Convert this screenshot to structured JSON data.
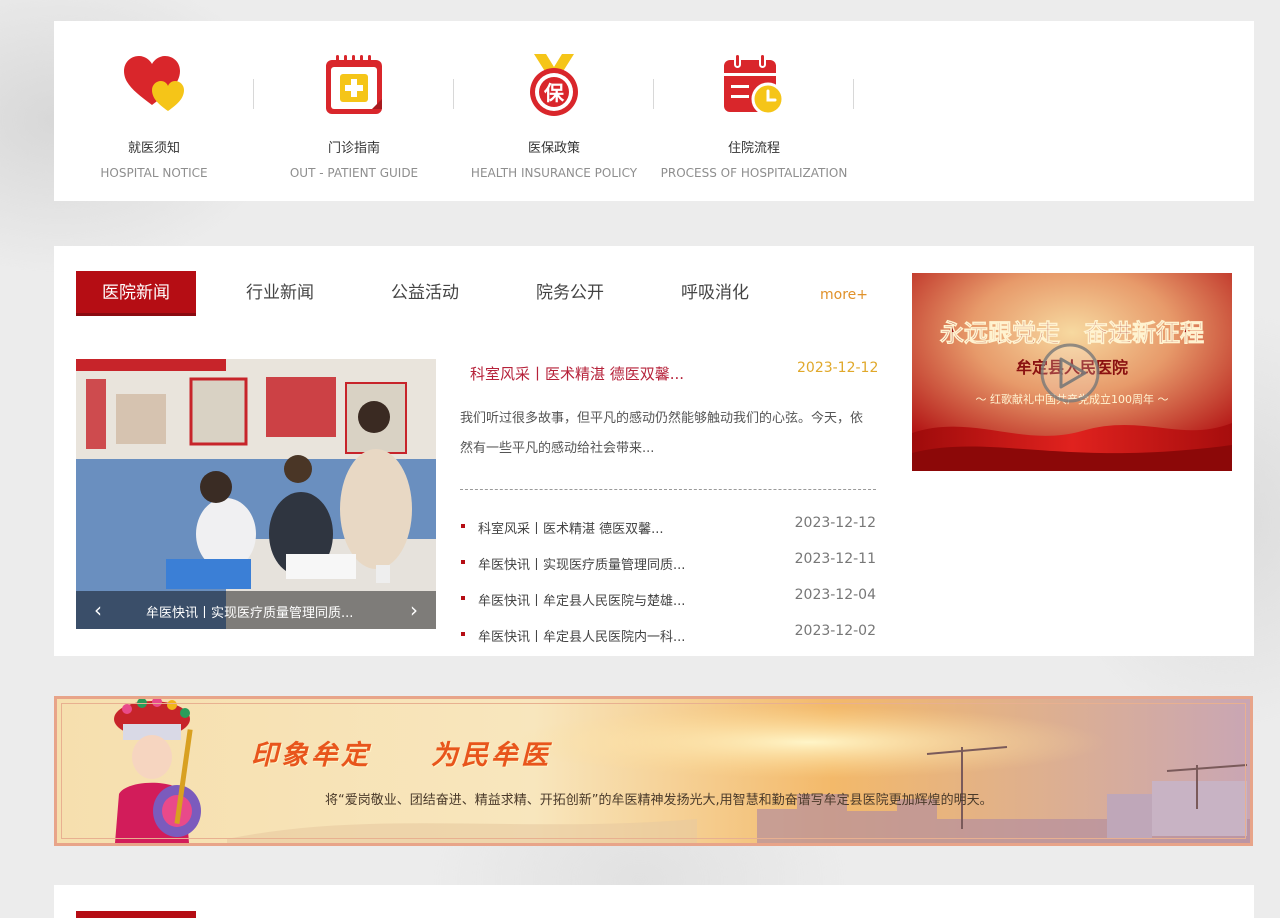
{
  "quick_links": [
    {
      "title": "就医须知",
      "subtitle": "HOSPITAL NOTICE",
      "icon": "hearts-icon"
    },
    {
      "title": "门诊指南",
      "subtitle": "OUT - PATIENT GUIDE",
      "icon": "medical-calendar-icon"
    },
    {
      "title": "医保政策",
      "subtitle": "HEALTH INSURANCE POLICY",
      "icon": "insurance-medal-icon"
    },
    {
      "title": "住院流程",
      "subtitle": "PROCESS OF HOSPITALIZATION",
      "icon": "calendar-clock-icon"
    }
  ],
  "medal_char": "保",
  "news": {
    "tabs": [
      "医院新闻",
      "行业新闻",
      "公益活动",
      "院务公开",
      "呼吸消化"
    ],
    "active_tab": 0,
    "more_label": "more+",
    "slider_caption": "牟医快讯丨实现医疗质量管理同质...",
    "featured": {
      "title": "科室风采丨医术精湛 德医双馨...",
      "date": "2023-12-12",
      "description": "我们听过很多故事，但平凡的感动仍然能够触动我们的心弦。今天，依然有一些平凡的感动给社会带来..."
    },
    "items": [
      {
        "title": "科室风采丨医术精湛 德医双馨...",
        "date": "2023-12-12"
      },
      {
        "title": "牟医快讯丨实现医疗质量管理同质...",
        "date": "2023-12-11"
      },
      {
        "title": "牟医快讯丨牟定县人民医院与楚雄...",
        "date": "2023-12-04"
      },
      {
        "title": "牟医快讯丨牟定县人民医院内一科...",
        "date": "2023-12-02"
      }
    ]
  },
  "video": {
    "headline": "永远跟党走　奋进新征程",
    "subline": "牟定县人民医院",
    "caption": "～ 红歌献礼中国共产党成立100周年 ～"
  },
  "banner": {
    "slogan": "印象牟定　　为民牟医",
    "description": "将“爱岗敬业、团结奋进、精益求精、开拓创新”的牟医精神发扬光大,用智慧和勤奋谱写牟定县医院更加辉煌的明天。"
  },
  "colors": {
    "brand_red": "#b50d14",
    "accent_gold": "#f5c518",
    "more_orange": "#e0912a",
    "featured_title": "#b6223a"
  }
}
